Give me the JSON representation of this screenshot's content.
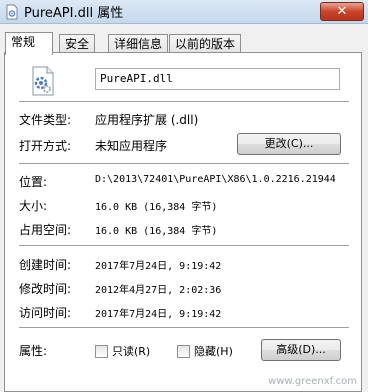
{
  "window": {
    "title": "PureAPI.dll 属性",
    "close_label": "✕"
  },
  "tabs": [
    {
      "label": "常规",
      "active": true
    },
    {
      "label": "安全",
      "active": false
    },
    {
      "label": "详细信息",
      "active": false
    },
    {
      "label": "以前的版本",
      "active": false
    }
  ],
  "general": {
    "file_name": "PureAPI.dll",
    "file_type_label": "文件类型:",
    "file_type_value": "应用程序扩展 (.dll)",
    "opens_with_label": "打开方式:",
    "opens_with_value": "未知应用程序",
    "change_button": "更改(C)...",
    "location_label": "位置:",
    "location_value": "D:\\2013\\72401\\PureAPI\\X86\\1.0.2216.21944",
    "size_label": "大小:",
    "size_value": "16.0 KB (16,384 字节)",
    "size_on_disk_label": "占用空间:",
    "size_on_disk_value": "16.0 KB (16,384 字节)",
    "created_label": "创建时间:",
    "created_value": "2017年7月24日, 9:19:42",
    "modified_label": "修改时间:",
    "modified_value": "2012年4月27日, 2:02:36",
    "accessed_label": "访问时间:",
    "accessed_value": "2017年7月24日, 9:19:42",
    "attributes_label": "属性:",
    "readonly_label": "只读(R)",
    "hidden_label": "隐藏(H)",
    "advanced_button": "高级(D)..."
  },
  "watermark": "www.greenxf.com",
  "colors": {
    "close_button": "#c8452b",
    "titlebar": "#c5d8ec"
  }
}
